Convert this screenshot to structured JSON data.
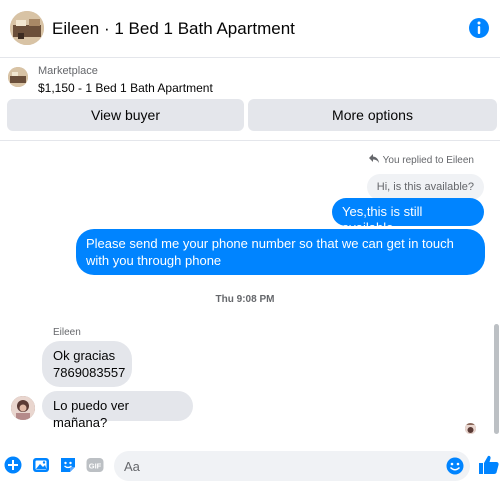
{
  "header": {
    "title": "Eileen · 1 Bed 1 Bath Apartment",
    "avatar_icon": "profile-photo",
    "info_icon": "info-icon"
  },
  "listing": {
    "label": "Marketplace",
    "price_title": "$1,150 - 1 Bed 1 Bath Apartment",
    "view_buyer": "View buyer",
    "more_options": "More options"
  },
  "messages": {
    "replied_note": "You replied to Eileen",
    "quoted": "Hi, is this available?",
    "out1": "Yes,this is still available",
    "out2": "Please send me your phone  number so that we can get in touch with you through phone",
    "timestamp": "Thu 9:08 PM",
    "sender_name": "Eileen",
    "in1_line1": "Ok gracias",
    "in1_line2": "7869083557",
    "in2": "Lo puedo ver mañana?"
  },
  "composer": {
    "placeholder": "Aa",
    "icons": [
      "plus-icon",
      "photo-icon",
      "sticker-icon",
      "gif-icon",
      "emoji-icon",
      "like-icon"
    ]
  },
  "colors": {
    "accent": "#0084ff",
    "bubble_in": "#e4e6eb",
    "muted_text": "#65676b"
  }
}
